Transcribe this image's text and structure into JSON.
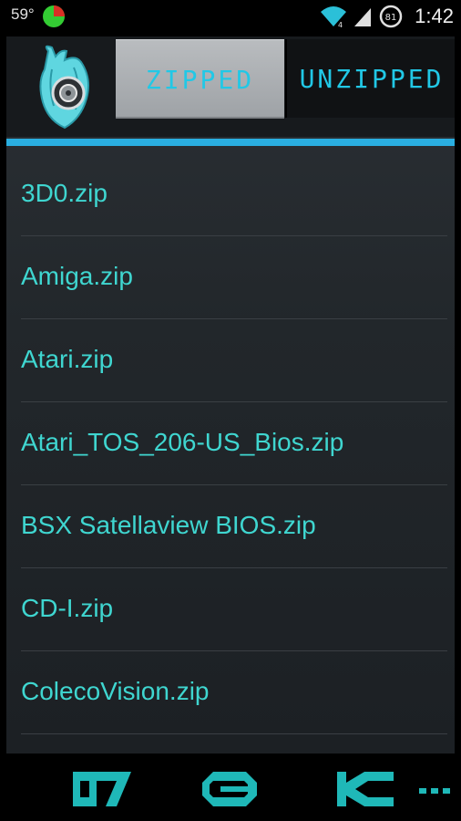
{
  "status_bar": {
    "temperature": "59°",
    "time": "1:42",
    "battery_level": "81",
    "icons": [
      "pie-usage-icon",
      "wifi-icon",
      "signal-icon",
      "battery-icon"
    ],
    "colors": {
      "pie_green": "#33cc33",
      "pie_red": "#d93025"
    }
  },
  "header": {
    "logo_icon": "heart-engine-logo-icon",
    "tabs": [
      {
        "label": "ZIPPED",
        "selected": true
      },
      {
        "label": "UNZIPPED",
        "selected": false
      }
    ],
    "colors": {
      "accent": "#2aaee0",
      "tab_text": "#21c8e6"
    }
  },
  "files": [
    {
      "label": "3D0.zip"
    },
    {
      "label": "Amiga.zip"
    },
    {
      "label": "Atari.zip"
    },
    {
      "label": "Atari_TOS_206-US_Bios.zip"
    },
    {
      "label": "BSX Satellaview BIOS.zip"
    },
    {
      "label": "CD-I.zip"
    },
    {
      "label": "ColecoVision.zip"
    }
  ],
  "file_text_color": "#3fd6d0",
  "nav_bar": {
    "buttons": [
      "back-icon",
      "home-icon",
      "recent-apps-icon",
      "menu-icon"
    ],
    "color": "#1fb8b8"
  }
}
